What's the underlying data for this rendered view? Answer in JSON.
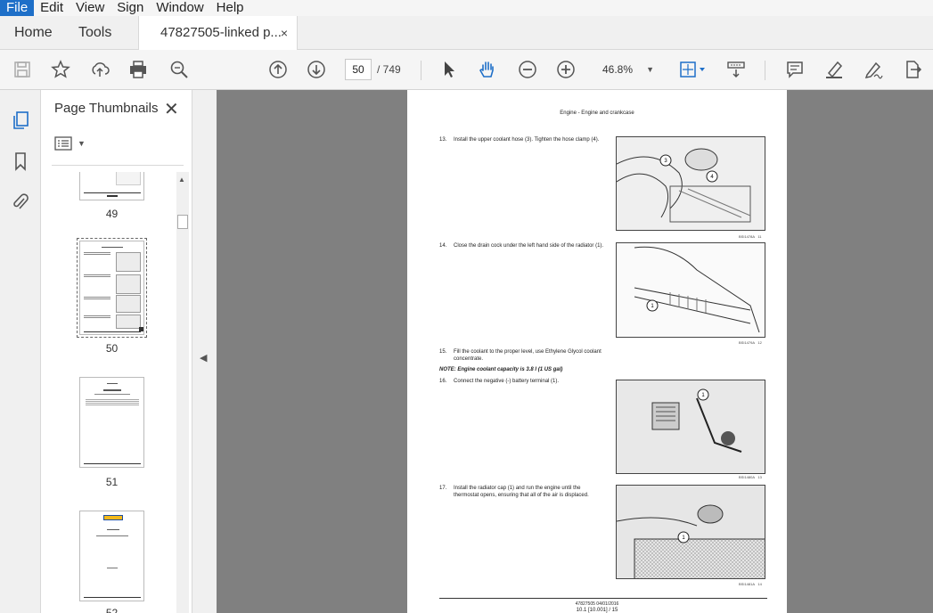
{
  "menu": [
    "File",
    "Edit",
    "View",
    "Sign",
    "Window",
    "Help"
  ],
  "tabs": {
    "home": "Home",
    "tools": "Tools",
    "doc": "47827505-linked p...",
    "close": "×"
  },
  "toolbar": {
    "current_page": "50",
    "page_total": "/  749",
    "zoom": "46.8%",
    "icons": [
      "save-icon",
      "star-icon",
      "upload-icon",
      "print-icon",
      "search-zoom-icon",
      "arrow-up-circle-icon",
      "arrow-down-circle-icon",
      "select-arrow-icon",
      "hand-icon",
      "zoom-out-icon",
      "zoom-in-icon",
      "fit-page-icon",
      "scroll-mode-icon",
      "comment-icon",
      "highlight-icon",
      "sign-icon",
      "export-icon"
    ]
  },
  "panel": {
    "title": "Page Thumbnails",
    "close": "✕",
    "thumbs": [
      {
        "label": "49"
      },
      {
        "label": "50",
        "selected": true
      },
      {
        "label": "51"
      },
      {
        "label": "52"
      }
    ]
  },
  "page": {
    "header": "Engine - Engine and crankcase",
    "steps": [
      {
        "n": "13.",
        "text": "Install the upper coolant hose (3).  Tighten the hose clamp (4)."
      },
      {
        "n": "14.",
        "text": "Close the drain cock under the left hand side of the radiator (1)."
      },
      {
        "n": "15.",
        "text": "Fill the coolant to the proper level, use Ethylene Glycol coolant concentrate."
      },
      {
        "n": "16.",
        "text": "Connect the negative (-) battery terminal (1)."
      },
      {
        "n": "17.",
        "text": "Install the radiator cap (1) and run the engine until the thermostat opens, ensuring that all of the air is displaced."
      }
    ],
    "note": "NOTE: Engine coolant capacity is 3.8 l (1 US gal)",
    "figures": [
      {
        "code": "BSI1478A",
        "num": "11"
      },
      {
        "code": "BSI1479A",
        "num": "12"
      },
      {
        "code": "BSI1480A",
        "num": "13"
      },
      {
        "code": "BSI1481A",
        "num": "14"
      }
    ],
    "footer1": "47827505 04/01/2016",
    "footer2": "10.1 [10.001] / 15"
  }
}
